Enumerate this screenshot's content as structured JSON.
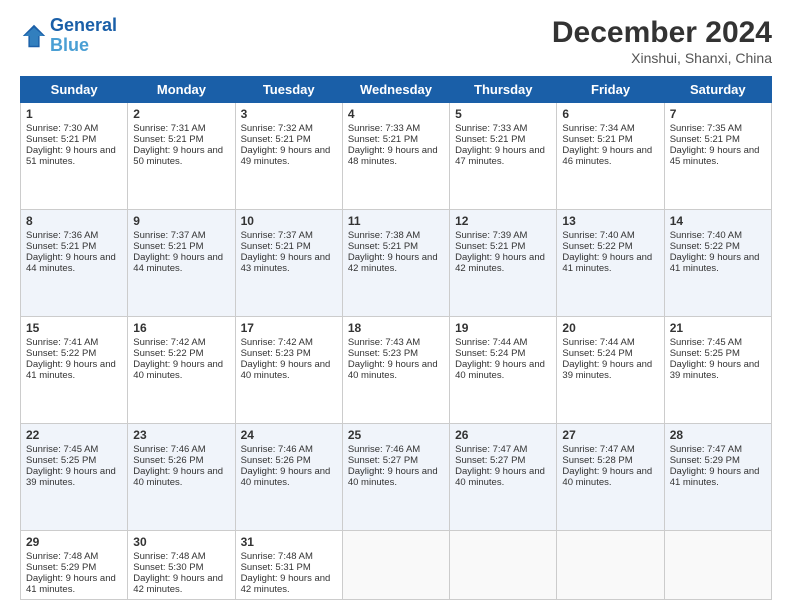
{
  "logo": {
    "line1": "General",
    "line2": "Blue"
  },
  "title": "December 2024",
  "subtitle": "Xinshui, Shanxi, China",
  "days_of_week": [
    "Sunday",
    "Monday",
    "Tuesday",
    "Wednesday",
    "Thursday",
    "Friday",
    "Saturday"
  ],
  "weeks": [
    [
      {
        "day": 1,
        "sunrise": "7:30 AM",
        "sunset": "5:21 PM",
        "daylight": "9 hours and 51 minutes."
      },
      {
        "day": 2,
        "sunrise": "7:31 AM",
        "sunset": "5:21 PM",
        "daylight": "9 hours and 50 minutes."
      },
      {
        "day": 3,
        "sunrise": "7:32 AM",
        "sunset": "5:21 PM",
        "daylight": "9 hours and 49 minutes."
      },
      {
        "day": 4,
        "sunrise": "7:33 AM",
        "sunset": "5:21 PM",
        "daylight": "9 hours and 48 minutes."
      },
      {
        "day": 5,
        "sunrise": "7:33 AM",
        "sunset": "5:21 PM",
        "daylight": "9 hours and 47 minutes."
      },
      {
        "day": 6,
        "sunrise": "7:34 AM",
        "sunset": "5:21 PM",
        "daylight": "9 hours and 46 minutes."
      },
      {
        "day": 7,
        "sunrise": "7:35 AM",
        "sunset": "5:21 PM",
        "daylight": "9 hours and 45 minutes."
      }
    ],
    [
      {
        "day": 8,
        "sunrise": "7:36 AM",
        "sunset": "5:21 PM",
        "daylight": "9 hours and 44 minutes."
      },
      {
        "day": 9,
        "sunrise": "7:37 AM",
        "sunset": "5:21 PM",
        "daylight": "9 hours and 44 minutes."
      },
      {
        "day": 10,
        "sunrise": "7:37 AM",
        "sunset": "5:21 PM",
        "daylight": "9 hours and 43 minutes."
      },
      {
        "day": 11,
        "sunrise": "7:38 AM",
        "sunset": "5:21 PM",
        "daylight": "9 hours and 42 minutes."
      },
      {
        "day": 12,
        "sunrise": "7:39 AM",
        "sunset": "5:21 PM",
        "daylight": "9 hours and 42 minutes."
      },
      {
        "day": 13,
        "sunrise": "7:40 AM",
        "sunset": "5:22 PM",
        "daylight": "9 hours and 41 minutes."
      },
      {
        "day": 14,
        "sunrise": "7:40 AM",
        "sunset": "5:22 PM",
        "daylight": "9 hours and 41 minutes."
      }
    ],
    [
      {
        "day": 15,
        "sunrise": "7:41 AM",
        "sunset": "5:22 PM",
        "daylight": "9 hours and 41 minutes."
      },
      {
        "day": 16,
        "sunrise": "7:42 AM",
        "sunset": "5:22 PM",
        "daylight": "9 hours and 40 minutes."
      },
      {
        "day": 17,
        "sunrise": "7:42 AM",
        "sunset": "5:23 PM",
        "daylight": "9 hours and 40 minutes."
      },
      {
        "day": 18,
        "sunrise": "7:43 AM",
        "sunset": "5:23 PM",
        "daylight": "9 hours and 40 minutes."
      },
      {
        "day": 19,
        "sunrise": "7:44 AM",
        "sunset": "5:24 PM",
        "daylight": "9 hours and 40 minutes."
      },
      {
        "day": 20,
        "sunrise": "7:44 AM",
        "sunset": "5:24 PM",
        "daylight": "9 hours and 39 minutes."
      },
      {
        "day": 21,
        "sunrise": "7:45 AM",
        "sunset": "5:25 PM",
        "daylight": "9 hours and 39 minutes."
      }
    ],
    [
      {
        "day": 22,
        "sunrise": "7:45 AM",
        "sunset": "5:25 PM",
        "daylight": "9 hours and 39 minutes."
      },
      {
        "day": 23,
        "sunrise": "7:46 AM",
        "sunset": "5:26 PM",
        "daylight": "9 hours and 40 minutes."
      },
      {
        "day": 24,
        "sunrise": "7:46 AM",
        "sunset": "5:26 PM",
        "daylight": "9 hours and 40 minutes."
      },
      {
        "day": 25,
        "sunrise": "7:46 AM",
        "sunset": "5:27 PM",
        "daylight": "9 hours and 40 minutes."
      },
      {
        "day": 26,
        "sunrise": "7:47 AM",
        "sunset": "5:27 PM",
        "daylight": "9 hours and 40 minutes."
      },
      {
        "day": 27,
        "sunrise": "7:47 AM",
        "sunset": "5:28 PM",
        "daylight": "9 hours and 40 minutes."
      },
      {
        "day": 28,
        "sunrise": "7:47 AM",
        "sunset": "5:29 PM",
        "daylight": "9 hours and 41 minutes."
      }
    ],
    [
      {
        "day": 29,
        "sunrise": "7:48 AM",
        "sunset": "5:29 PM",
        "daylight": "9 hours and 41 minutes."
      },
      {
        "day": 30,
        "sunrise": "7:48 AM",
        "sunset": "5:30 PM",
        "daylight": "9 hours and 42 minutes."
      },
      {
        "day": 31,
        "sunrise": "7:48 AM",
        "sunset": "5:31 PM",
        "daylight": "9 hours and 42 minutes."
      },
      null,
      null,
      null,
      null
    ]
  ],
  "labels": {
    "sunrise": "Sunrise:",
    "sunset": "Sunset:",
    "daylight": "Daylight:"
  }
}
